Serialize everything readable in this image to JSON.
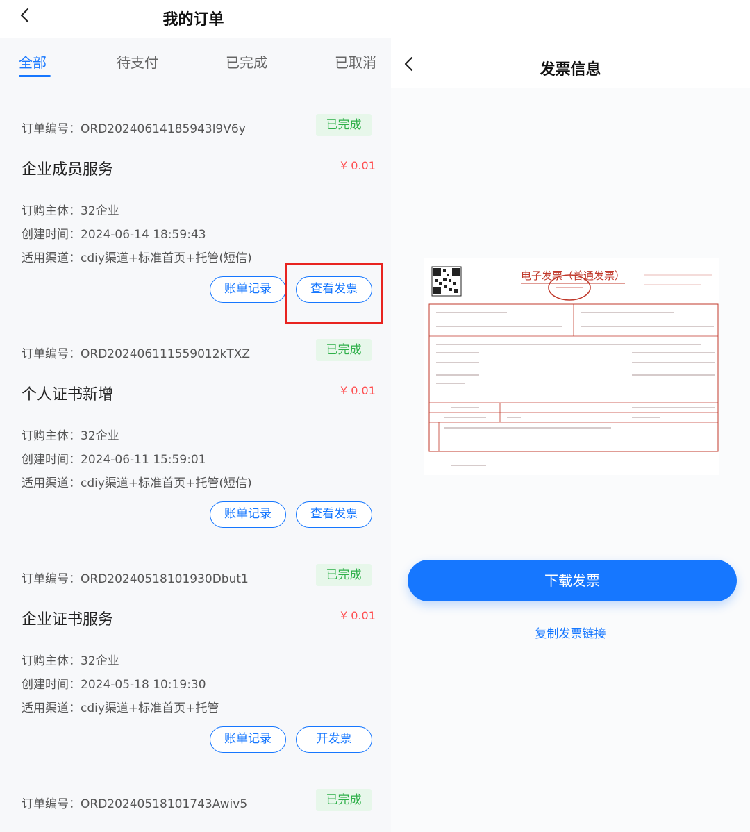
{
  "left": {
    "title": "我的订单",
    "tabs": [
      {
        "label": "全部",
        "active": true
      },
      {
        "label": "待支付",
        "active": false
      },
      {
        "label": "已完成",
        "active": false
      },
      {
        "label": "已取消",
        "active": false
      }
    ],
    "orders": [
      {
        "order_no": "订单编号：ORD20240614185943l9V6y",
        "status": "已完成",
        "product": "企业成员服务",
        "price": "¥ 0.01",
        "subject": "订购主体：32企业",
        "created": "创建时间：2024-06-14 18:59:43",
        "channel": "适用渠道：cdiy渠道+标准首页+托管(短信)",
        "btn_bill": "账单记录",
        "btn_invoice": "查看发票"
      },
      {
        "order_no": "订单编号：ORD202406111559012kTXZ",
        "status": "已完成",
        "product": "个人证书新增",
        "price": "¥ 0.01",
        "subject": "订购主体：32企业",
        "created": "创建时间：2024-06-11 15:59:01",
        "channel": "适用渠道：cdiy渠道+标准首页+托管(短信)",
        "btn_bill": "账单记录",
        "btn_invoice": "查看发票"
      },
      {
        "order_no": "订单编号：ORD20240518101930Dbut1",
        "status": "已完成",
        "product": "企业证书服务",
        "price": "¥ 0.01",
        "subject": "订购主体：32企业",
        "created": "创建时间：2024-05-18 10:19:30",
        "channel": "适用渠道：cdiy渠道+标准首页+托管",
        "btn_bill": "账单记录",
        "btn_invoice": "开发票"
      },
      {
        "order_no": "订单编号：ORD20240518101743Awiv5",
        "status": "已完成"
      }
    ]
  },
  "right": {
    "title": "发票信息",
    "invoice_title": "电子发票（普通发票）",
    "download_label": "下载发票",
    "copy_link_label": "复制发票链接"
  },
  "colors": {
    "accent": "#1677ff",
    "status_green": "#2fb04a",
    "status_green_bg": "#e7f7ea",
    "price_red": "#ff4d4f",
    "highlight_red": "#e8231f",
    "invoice_red": "#c0392b"
  },
  "icons": {
    "back": "chevron-left-icon"
  }
}
